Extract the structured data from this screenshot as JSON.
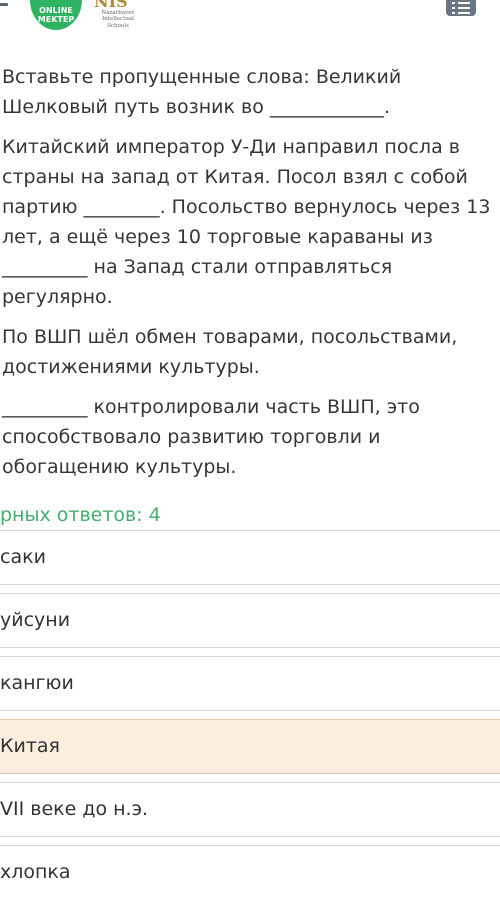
{
  "header": {
    "logo_online_line1": "ONLINE",
    "logo_online_line2": "MEKTEP",
    "logo_nis_mark": "NIS",
    "logo_nis_sub1": "Nazarbayev",
    "logo_nis_sub2": "Intellectual",
    "logo_nis_sub3": "Schools"
  },
  "question": {
    "line1": "Вставьте пропущенные слова: Великий Шелковый путь возник во ____________.",
    "line2": "Китайский император У-Ди направил посла в страны на запад от Китая. Посол взял с собой партию ________. Посольство вернулось через 13 лет, а ещё через 10 торговые караваны из _________ на Запад стали отправляться регулярно.",
    "line3": "По ВШП шёл обмен товарами, посольствами, достижениями культуры.",
    "line4": "_________ контролировали часть ВШП, это способствовало развитию торговли и обогащению культуры."
  },
  "answers_count": "рных ответов: 4",
  "options": [
    {
      "label": "саки",
      "selected": false
    },
    {
      "label": "уйсуни",
      "selected": false
    },
    {
      "label": "кангюи",
      "selected": false
    },
    {
      "label": "Китая",
      "selected": true
    },
    {
      "label": "VII веке до н.э.",
      "selected": false
    },
    {
      "label": "хлопка",
      "selected": false
    }
  ],
  "colors": {
    "accent_green": "#41b06f",
    "selected_bg": "#fbeede"
  }
}
